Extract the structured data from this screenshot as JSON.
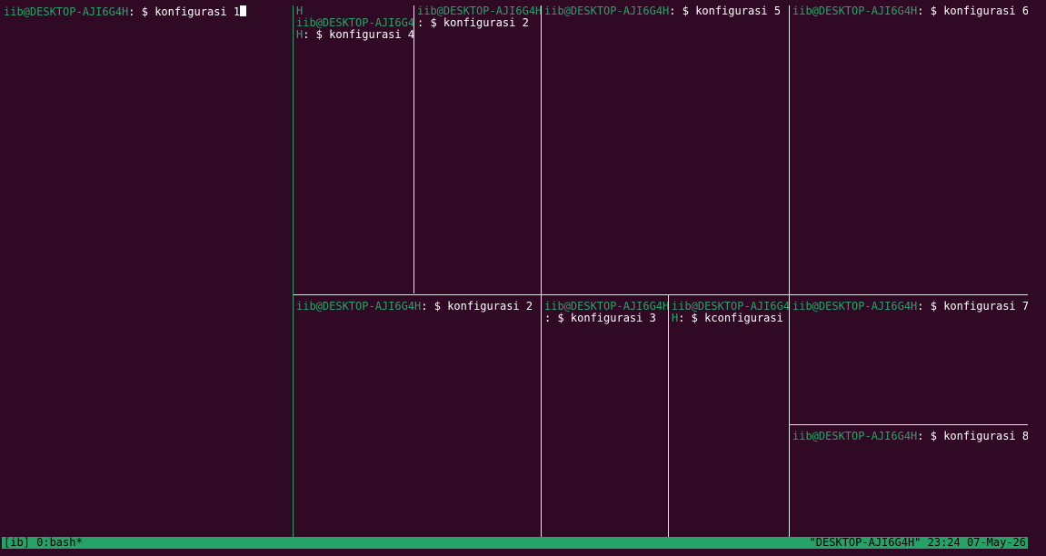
{
  "panes": {
    "p1": {
      "user": "iib@DESKTOP-AJI6G4H",
      "sep": ": $ ",
      "cmd": "konfigurasi 1"
    },
    "p4": {
      "user_prefix": "H",
      "user_line": "iib@DESKTOP-AJI6G4",
      "user_tail": "H",
      "sep": ": $ ",
      "cmd": "konfigurasi 4"
    },
    "p2a": {
      "user": "iib@DESKTOP-AJI6G4H",
      "sep": ": $ ",
      "cmd": "konfigurasi 2"
    },
    "p5": {
      "user": "iib@DESKTOP-AJI6G4H",
      "sep": ": $ ",
      "cmd": "konfigurasi 5"
    },
    "p6": {
      "user": "iib@DESKTOP-AJI6G4H",
      "sep": ": $ ",
      "cmd": "konfigurasi 6"
    },
    "p2b": {
      "user": "iib@DESKTOP-AJI6G4H",
      "sep": ": $ ",
      "cmd": "konfigurasi 2"
    },
    "p3": {
      "user": "iib@DESKTOP-AJI6G4H",
      "sep": ": $ ",
      "cmd": "konfigurasi 3"
    },
    "pk": {
      "user_line": "iib@DESKTOP-AJI6G4",
      "user_tail": "H",
      "sep": ": $ ",
      "cmd": "kconfigurasi"
    },
    "p7": {
      "user": "iib@DESKTOP-AJI6G4H",
      "sep": ": $ ",
      "cmd": "konfigurasi 7"
    },
    "p8": {
      "user": "iib@DESKTOP-AJI6G4H",
      "sep": ": $ ",
      "cmd": "konfigurasi 8"
    }
  },
  "status_bar": {
    "left": "[ib] 0:bash*",
    "right": "\"DESKTOP-AJI6G4H\" 23:24 07-May-26"
  },
  "colors": {
    "background": "#300a24",
    "prompt_user": "#26a269",
    "status_bar": "#26a269",
    "active_border": "#26a269",
    "inactive_border": "#e6e6e6"
  }
}
